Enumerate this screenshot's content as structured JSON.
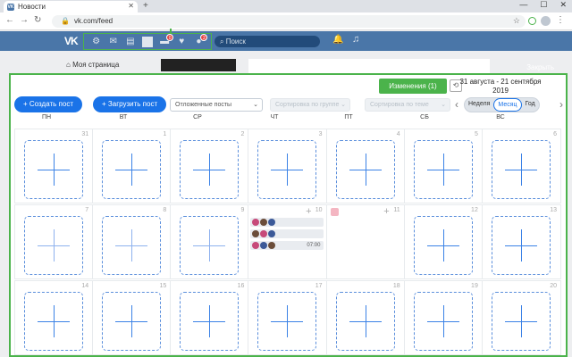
{
  "browser": {
    "tab_title": "Новости",
    "tab_favicon": "VK",
    "url": "vk.com/feed"
  },
  "vk": {
    "logo": "VK",
    "search_placeholder": "Поиск",
    "nav_badges": {
      "cards": "0",
      "profile": "2"
    },
    "my_page": "Моя страница"
  },
  "overlay": {
    "close": "Закрыть",
    "create_post": "Создать пост",
    "upload_post": "Загрузить пост",
    "deferred": "Отложенные посты",
    "sort_group": "Сортировка по группе",
    "sort_theme": "Сортировка по теме",
    "changes": "Изменения (1)",
    "date_range": "31 августа - 21 сентября 2019",
    "prev": "‹",
    "next": "›",
    "views": [
      "Неделя",
      "Месяц",
      "Год"
    ],
    "active_view": "Месяц",
    "plus_sign": "+",
    "weekdays": [
      "ПН",
      "ВТ",
      "СР",
      "ЧТ",
      "ПТ",
      "СБ",
      "ВС"
    ],
    "weeks": [
      [
        "31",
        "1",
        "2",
        "3",
        "4",
        "5",
        "6"
      ],
      [
        "7",
        "8",
        "9",
        "10",
        "11",
        "12",
        "13"
      ],
      [
        "14",
        "15",
        "16",
        "17",
        "18",
        "19",
        "20"
      ]
    ],
    "posts_day10": [
      {
        "time": ""
      },
      {
        "time": ""
      },
      {
        "time": "07:00"
      }
    ]
  },
  "colors": {
    "vk_blue": "#4a76a8",
    "accent_blue": "#1a73e8",
    "highlight_green": "#4bb34b"
  }
}
